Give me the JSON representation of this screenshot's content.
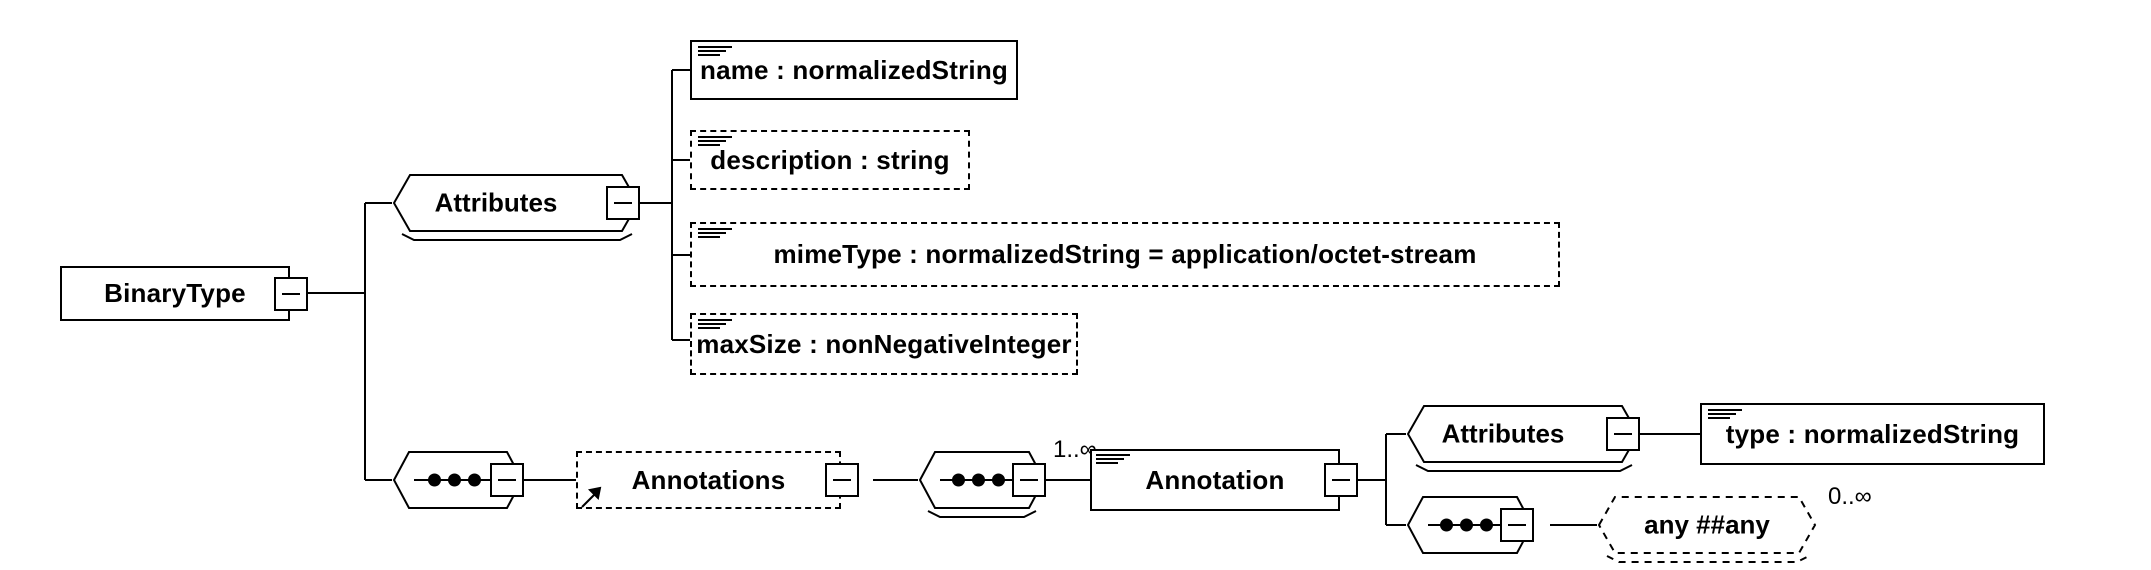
{
  "diagram": {
    "kind": "xml-schema-element-diagram",
    "root": {
      "name": "BinaryType",
      "shape": "element-box",
      "collapse_control": "minus"
    },
    "attributes_group_label": "Attributes",
    "sequence_symbol": "sequence-dots",
    "attributes": [
      {
        "label": "name : normalizedString",
        "required": true,
        "border": "solid",
        "marker": "attribute-marker"
      },
      {
        "label": "description : string",
        "required": false,
        "border": "dashed",
        "marker": "attribute-marker"
      },
      {
        "label": "mimeType : normalizedString = application/octet-stream",
        "required": false,
        "border": "dashed",
        "marker": "attribute-marker"
      },
      {
        "label": "maxSize : nonNegativeInteger",
        "required": false,
        "border": "dashed",
        "marker": "attribute-marker"
      }
    ],
    "annotations_ref": {
      "label": "Annotations",
      "border": "dashed",
      "is_reference": true
    },
    "annotation": {
      "label": "Annotation",
      "border": "solid",
      "cardinality": "1..∞",
      "attributes_group_label": "Attributes",
      "attributes": [
        {
          "label": "type : normalizedString",
          "required": true,
          "border": "solid",
          "marker": "attribute-marker"
        }
      ],
      "wildcard": {
        "label": "any  ##any",
        "border": "dashed",
        "cardinality": "0..∞"
      }
    },
    "colors": {
      "line": "#000000",
      "background": "#ffffff",
      "text": "#000000"
    }
  }
}
